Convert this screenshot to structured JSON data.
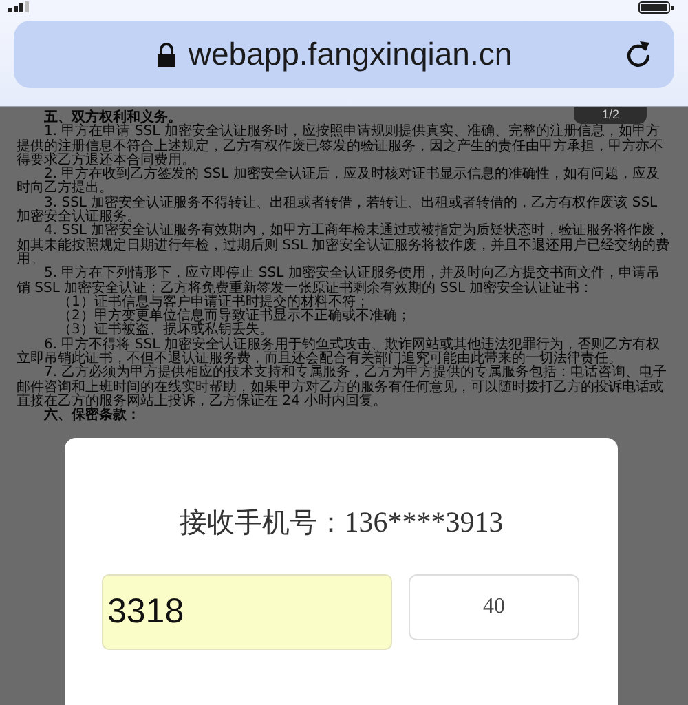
{
  "browser": {
    "url": "webapp.fangxinqian.cn"
  },
  "page_indicator": "1/2",
  "document": {
    "paragraphs": [
      {
        "kind": "heading",
        "text": "五、双方权利和义务。"
      },
      {
        "kind": "paragraph",
        "text": "1. 甲方在申请 SSL 加密安全认证服务时，应按照申请规则提供真实、准确、完整的注册信息，如甲方提供的注册信息不符合上述规定，乙方有权作废已签发的验证服务，因之产生的责任由甲方承担，甲方亦不得要求乙方退还本合同费用。"
      },
      {
        "kind": "paragraph",
        "text": "2. 甲方在收到乙方签发的 SSL 加密安全认证后，应及时核对证书显示信息的准确性，如有问题，应及时向乙方提出。"
      },
      {
        "kind": "paragraph",
        "text": "3. SSL 加密安全认证服务不得转让、出租或者转借，若转让、出租或者转借的，乙方有权作废该 SSL 加密安全认证服务。"
      },
      {
        "kind": "paragraph",
        "text": "4. SSL 加密安全认证服务有效期内，如甲方工商年检未通过或被指定为质疑状态时，验证服务将作废，如其未能按照规定日期进行年检，过期后则 SSL 加密安全认证服务将被作废，并且不退还用户已经交纳的费用。"
      },
      {
        "kind": "paragraph",
        "text": "5. 甲方在下列情形下，应立即停止 SSL 加密安全认证服务使用，并及时向乙方提交书面文件，申请吊销 SSL 加密安全认证；乙方将免费重新签发一张原证书剩余有效期的 SSL 加密安全认证证书："
      },
      {
        "kind": "item",
        "text": "（1）证书信息与客户申请证书时提交的材料不符；"
      },
      {
        "kind": "item",
        "text": "（2）甲方变更单位信息而导致证书显示不正确或不准确；"
      },
      {
        "kind": "item",
        "text": "（3）证书被盗、损坏或私钥丢失。"
      },
      {
        "kind": "paragraph",
        "text": "6. 甲方不得将 SSL 加密安全认证服务用于钓鱼式攻击、欺诈网站或其他违法犯罪行为，否则乙方有权立即吊销此证书，不但不退认证服务费，而且还会配合有关部门追究可能由此带来的一切法律责任。"
      },
      {
        "kind": "paragraph",
        "text": "7. 乙方必须为甲方提供相应的技术支持和专属服务，乙方为甲方提供的专属服务包括：电话咨询、电子邮件咨询和上班时间的在线实时帮助，如果甲方对乙方的服务有任何意见，可以随时拨打乙方的投诉电话或直接在乙方的服务网站上投诉，乙方保证在 24 小时内回复。"
      },
      {
        "kind": "heading",
        "text": "六、保密条款："
      }
    ]
  },
  "dialog": {
    "label": "接收手机号：",
    "phone": "136****3913",
    "code_input": {
      "value": "3318"
    },
    "countdown": "40"
  }
}
